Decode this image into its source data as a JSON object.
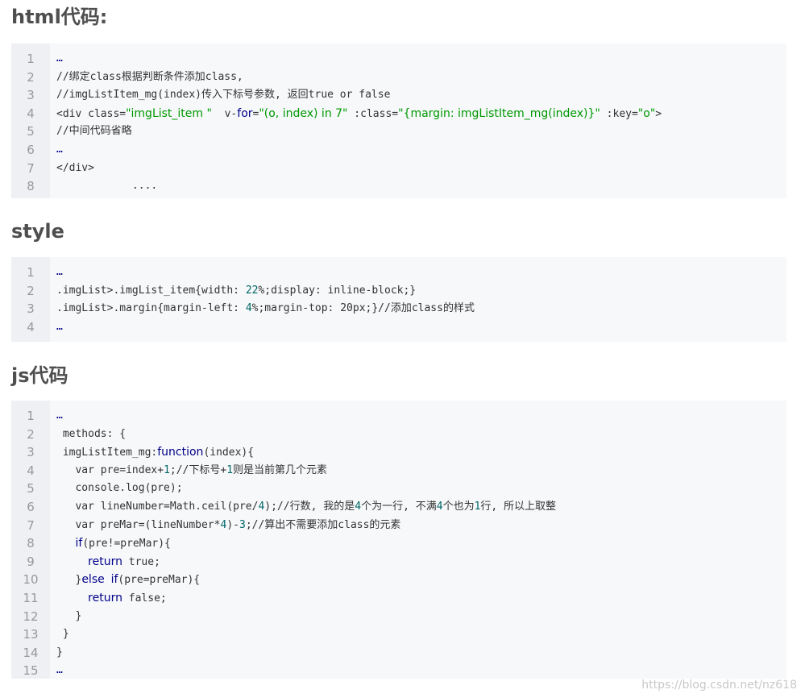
{
  "sections": {
    "html": {
      "title": "html代码:",
      "lines": [
        [
          {
            "t": "…",
            "c": "ellipsis"
          }
        ],
        [
          {
            "t": "//绑定class根据判断条件添加class,"
          }
        ],
        [
          {
            "t": "//imgListItem_mg(index)传入下标号参数, 返回true or false"
          }
        ],
        [
          {
            "t": "<div class="
          },
          {
            "t": "\"imgList_item \"",
            "c": "str"
          },
          {
            "t": "  v-"
          },
          {
            "t": "for",
            "c": "kw"
          },
          {
            "t": "="
          },
          {
            "t": "\"(o, index) in 7\"",
            "c": "str"
          },
          {
            "t": " :class="
          },
          {
            "t": "\"{margin: imgListItem_mg(index)}\"",
            "c": "str"
          },
          {
            "t": " :key="
          },
          {
            "t": "\"o\"",
            "c": "str"
          },
          {
            "t": ">"
          }
        ],
        [
          {
            "t": "//中间代码省略"
          }
        ],
        [
          {
            "t": "…",
            "c": "ellipsis"
          }
        ],
        [
          {
            "t": "</div>"
          }
        ],
        [
          {
            "t": "            ...."
          }
        ]
      ]
    },
    "style": {
      "title": "style",
      "lines": [
        [
          {
            "t": "…",
            "c": "ellipsis"
          }
        ],
        [
          {
            "t": ".imgList>.imgList_item{width: "
          },
          {
            "t": "22",
            "c": "num"
          },
          {
            "t": "%;display: inline-block;}"
          }
        ],
        [
          {
            "t": ".imgList>.margin{margin-left: "
          },
          {
            "t": "4",
            "c": "num"
          },
          {
            "t": "%;margin-top: 20px;}//添加class的样式"
          }
        ],
        [
          {
            "t": "…",
            "c": "ellipsis"
          }
        ]
      ]
    },
    "js": {
      "title": "js代码",
      "lines": [
        [
          {
            "t": "…",
            "c": "ellipsis"
          }
        ],
        [
          {
            "t": " methods: {"
          }
        ],
        [
          {
            "t": " imgListItem_mg:"
          },
          {
            "t": "function",
            "c": "kw"
          },
          {
            "t": "(index){"
          }
        ],
        [
          {
            "t": "   var pre=index+"
          },
          {
            "t": "1",
            "c": "num"
          },
          {
            "t": ";//下标号+"
          },
          {
            "t": "1",
            "c": "num"
          },
          {
            "t": "则是当前第几个元素"
          }
        ],
        [
          {
            "t": "   console.log(pre);"
          }
        ],
        [
          {
            "t": "   var lineNumber=Math.ceil(pre/"
          },
          {
            "t": "4",
            "c": "num"
          },
          {
            "t": ");//行数, 我的是"
          },
          {
            "t": "4",
            "c": "num"
          },
          {
            "t": "个为一行, 不满"
          },
          {
            "t": "4",
            "c": "num"
          },
          {
            "t": "个也为"
          },
          {
            "t": "1",
            "c": "num"
          },
          {
            "t": "行, 所以上取整"
          }
        ],
        [
          {
            "t": "   var preMar=(lineNumber*"
          },
          {
            "t": "4",
            "c": "num"
          },
          {
            "t": ")-"
          },
          {
            "t": "3",
            "c": "num"
          },
          {
            "t": ";//算出不需要添加class的元素"
          }
        ],
        [
          {
            "t": "   "
          },
          {
            "t": "if",
            "c": "kw"
          },
          {
            "t": "(pre!=preMar){"
          }
        ],
        [
          {
            "t": "     "
          },
          {
            "t": "return",
            "c": "kw"
          },
          {
            "t": " true;"
          }
        ],
        [
          {
            "t": "   }"
          },
          {
            "t": "else",
            "c": "kw"
          },
          {
            "t": " "
          },
          {
            "t": "if",
            "c": "kw"
          },
          {
            "t": "(pre=preMar){"
          }
        ],
        [
          {
            "t": "     "
          },
          {
            "t": "return",
            "c": "kw"
          },
          {
            "t": " false;"
          }
        ],
        [
          {
            "t": "   }"
          }
        ],
        [
          {
            "t": " }"
          }
        ],
        [
          {
            "t": "}"
          }
        ],
        [
          {
            "t": "…",
            "c": "ellipsis"
          }
        ]
      ]
    }
  },
  "watermark": "https://blog.csdn.net/nz618"
}
